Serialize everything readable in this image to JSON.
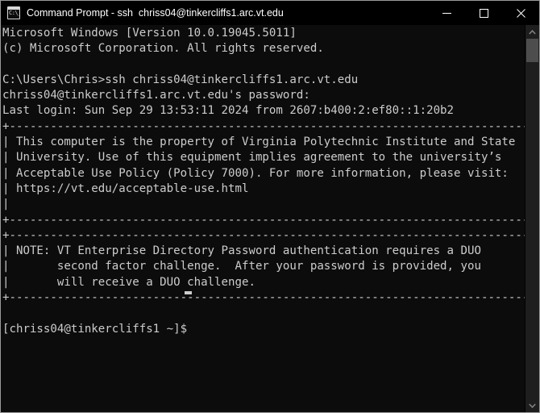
{
  "window": {
    "title": "Command Prompt - ssh  chriss04@tinkercliffs1.arc.vt.edu",
    "icon_glyph": "C:\\_",
    "background_color": "#0c0c0c",
    "text_color": "#cccccc",
    "border_color": "#9a9a9a",
    "controls": {
      "minimize_label": "Minimize",
      "maximize_label": "Maximize",
      "close_label": "Close"
    }
  },
  "scrollbar": {
    "up_arrow_label": "Scroll up",
    "down_arrow_label": "Scroll down",
    "thumb_label": "Scroll thumb",
    "thumb_color": "#4d4d4d",
    "track_color": "#1e1e1e"
  },
  "terminal": {
    "prompt": "[chriss04@tinkercliffs1 ~]$",
    "cursor": "_",
    "lines": [
      "Microsoft Windows [Version 10.0.19045.5011]",
      "(c) Microsoft Corporation. All rights reserved.",
      "",
      "C:\\Users\\Chris>ssh chriss04@tinkercliffs1.arc.vt.edu",
      "chriss04@tinkercliffs1.arc.vt.edu's password:",
      "Last login: Sun Sep 29 13:53:11 2024 from 2607:b400:2:ef80::1:20b2",
      "+----------------------------------------------------------------------------+",
      "| This computer is the property of Virginia Polytechnic Institute and State   |",
      "| University. Use of this equipment implies agreement to the university’s    |",
      "| Acceptable Use Policy (Policy 7000). For more information, please visit:    |",
      "| https://vt.edu/acceptable-use.html                                          |",
      "|                                                                            |",
      "+----------------------------------------------------------------------------+",
      "+----------------------------------------------------------------------------+",
      "| NOTE: VT Enterprise Directory Password authentication requires a DUO        |",
      "|       second factor challenge.  After your password is provided, you        |",
      "|       will receive a DUO challenge.                                         |",
      "+----------------------------------------------------------------------------+",
      "",
      "[chriss04@tinkercliffs1 ~]$ "
    ],
    "full_text": "Microsoft Windows [Version 10.0.19045.5011]\n(c) Microsoft Corporation. All rights reserved.\n\nC:\\Users\\Chris>ssh chriss04@tinkercliffs1.arc.vt.edu\nchriss04@tinkercliffs1.arc.vt.edu's password:\nLast login: Sun Sep 29 13:53:11 2024 from 2607:b400:2:ef80::1:20b2\n+----------------------------------------------------------------------------+\n| This computer is the property of Virginia Polytechnic Institute and State   |\n| University. Use of this equipment implies agreement to the university’s    |\n| Acceptable Use Policy (Policy 7000). For more information, please visit:    |\n| https://vt.edu/acceptable-use.html                                          |\n|                                                                            |\n+----------------------------------------------------------------------------+\n+----------------------------------------------------------------------------+\n| NOTE: VT Enterprise Directory Password authentication requires a DUO        |\n|       second factor challenge.  After your password is provided, you        |\n|       will receive a DUO challenge.                                         |\n+----------------------------------------------------------------------------+\n\n[chriss04@tinkercliffs1 ~]$ "
  }
}
